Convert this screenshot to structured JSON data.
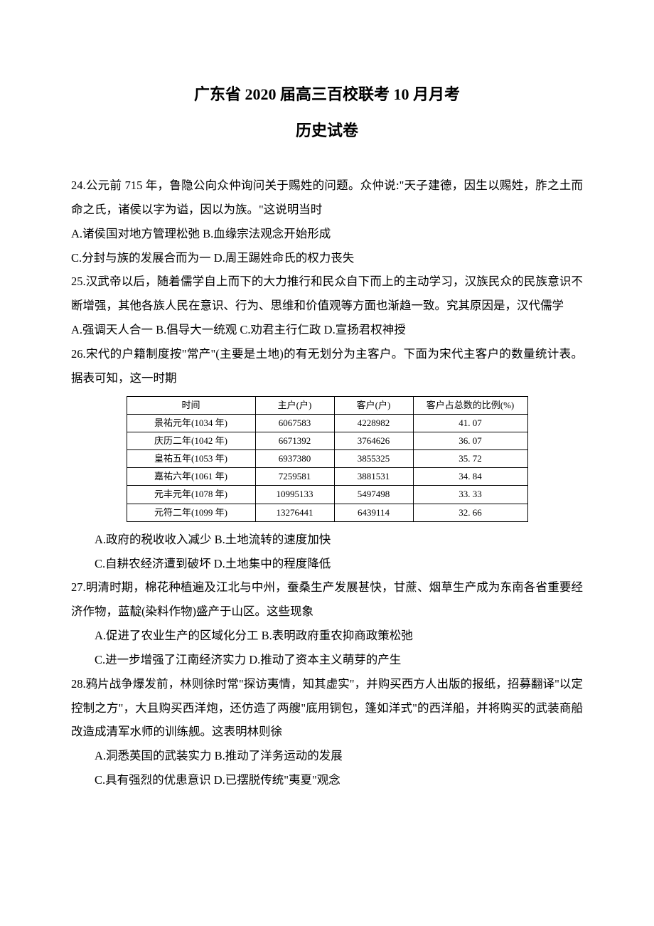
{
  "title": "广东省 2020 届高三百校联考 10 月月考",
  "subtitle": "历史试卷",
  "q24": {
    "text": "24.公元前 715 年，鲁隐公向众仲询问关于赐姓的问题。众仲说:\"天子建德，因生以赐姓，胙之土而命之氏，诸侯以字为谥，因以为族。\"这说明当时",
    "opt_line1": "A.诸侯国对地方管理松弛 B.血缘宗法观念开始形成",
    "opt_line2": "C.分封与族的发展合而为一 D.周王踢姓命氏的权力丧失"
  },
  "q25": {
    "text": "25.汉武帝以后，随着儒学自上而下的大力推行和民众自下而上的主动学习，汉族民众的民族意识不断增强，其他各族人民在意识、行为、思维和价值观等方面也渐趋一致。究其原因是，汉代儒学",
    "opt_line1": "A.强调天人合一 B.倡导大一统观 C.劝君主行仁政 D.宣扬君权神授"
  },
  "q26": {
    "text": "26.宋代的户籍制度按\"常产\"(主要是土地)的有无划分为主客户。下面为宋代主客户的数量统计表。据表可知，这一时期",
    "opt_line1": "A.政府的税收收入减少 B.土地流转的速度加快",
    "opt_line2": "C.自耕农经济遭到破坏 D.土地集中的程度降低"
  },
  "q27": {
    "text": "27.明清时期，棉花种植遍及江北与中州，蚕桑生产发展甚快，甘蔗、烟草生产成为东南各省重要经济作物，蓝靛(染料作物)盛产于山区。这些现象",
    "opt_line1": "A.促进了农业生产的区域化分工 B.表明政府重农抑商政策松弛",
    "opt_line2": "C.进一步增强了江南经济实力 D.推动了资本主义萌芽的产生"
  },
  "q28": {
    "text": "28.鸦片战争爆发前，林则徐时常\"探访夷情，知其虚实\"，并购买西方人出版的报纸，招募翻译\"以定控制之方\"，大且购买西洋炮，还仿造了两艘\"底用铜包，篷如洋式\"的西洋船，并将购买的武装商船改造成清军水师的训练舰。这表明林则徐",
    "opt_line1": "A.洞悉英国的武装实力 B.推动了洋务运动的发展",
    "opt_line2": "C.具有强烈的优患意识 D.已摆脱传统\"夷夏\"观念"
  },
  "chart_data": {
    "type": "table",
    "headers": {
      "time": "时间",
      "main": "主户(户)",
      "guest": "客户(户)",
      "ratio": "客户占总数的比例(%)"
    },
    "rows": [
      {
        "time": "景祐元年(1034 年)",
        "main": "6067583",
        "guest": "4228982",
        "ratio": "41. 07"
      },
      {
        "time": "庆历二年(1042 年)",
        "main": "6671392",
        "guest": "3764626",
        "ratio": "36. 07"
      },
      {
        "time": "皇祐五年(1053 年)",
        "main": "6937380",
        "guest": "3855325",
        "ratio": "35. 72"
      },
      {
        "time": "嘉祐六年(1061 年)",
        "main": "7259581",
        "guest": "3881531",
        "ratio": "34. 84"
      },
      {
        "time": "元丰元年(1078 年)",
        "main": "10995133",
        "guest": "5497498",
        "ratio": "33. 33"
      },
      {
        "time": "元符二年(1099 年)",
        "main": "13276441",
        "guest": "6439114",
        "ratio": "32. 66"
      }
    ]
  }
}
